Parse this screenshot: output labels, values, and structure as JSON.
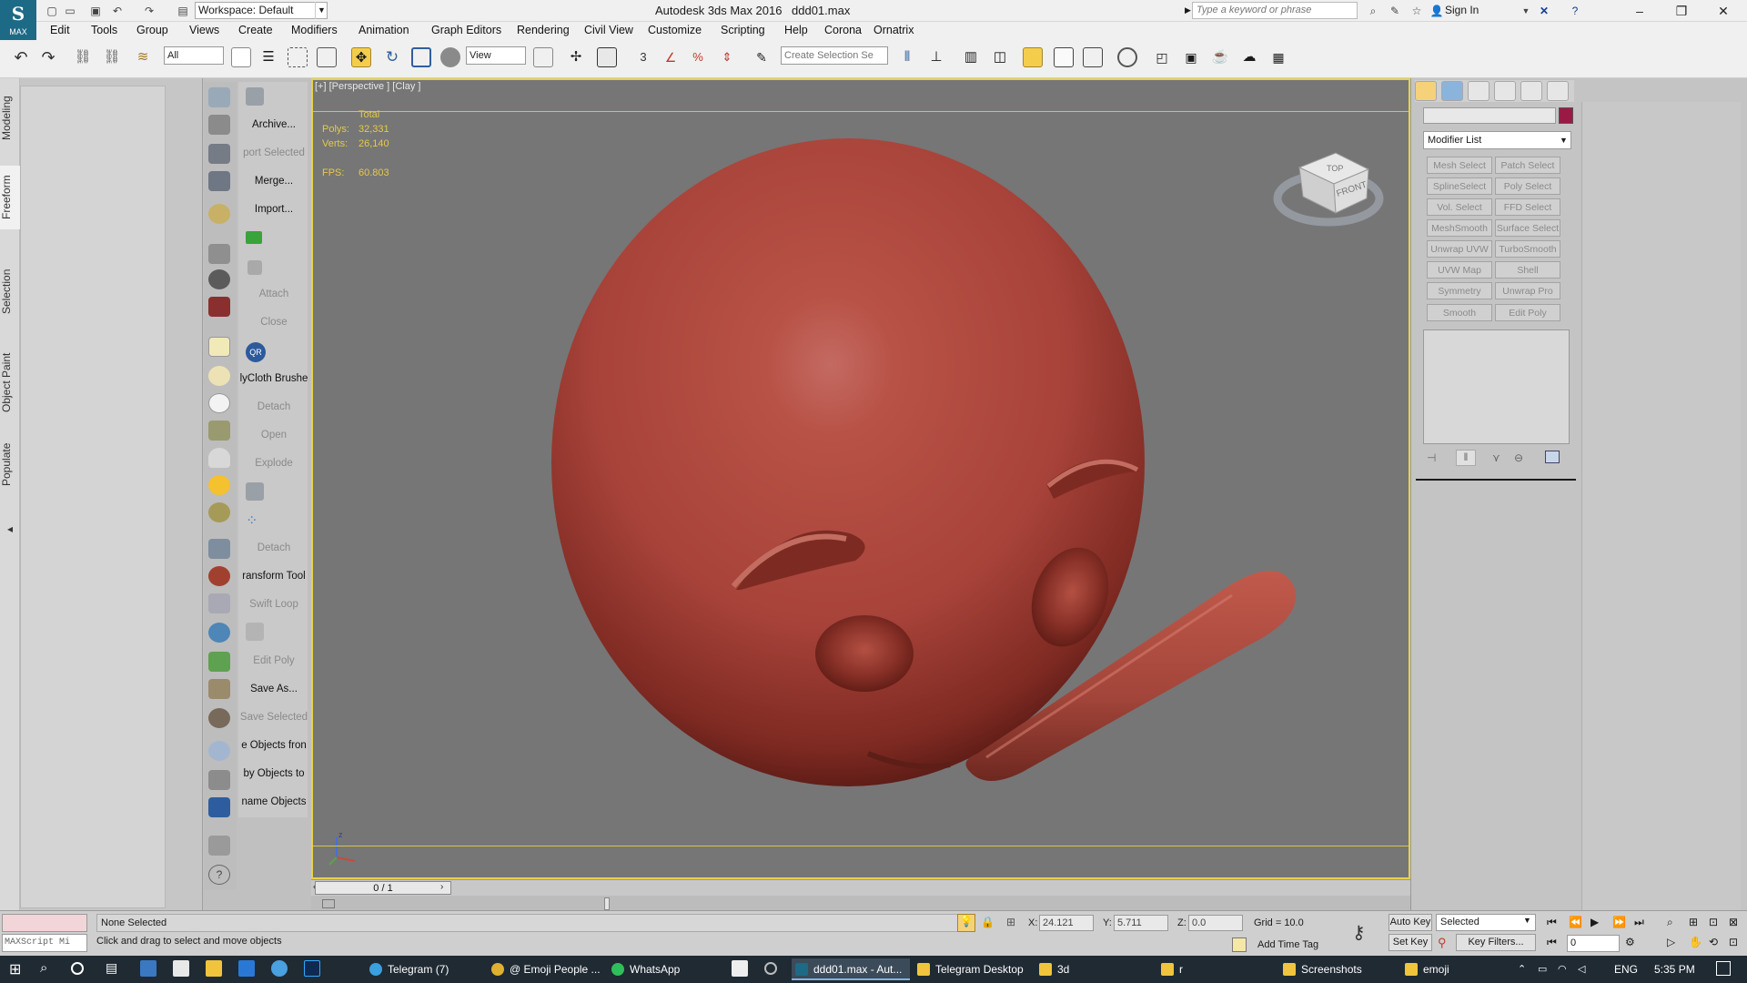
{
  "titlebar": {
    "app_logo_text": "MAX",
    "workspace": "Workspace: Default",
    "app_title": "Autodesk 3ds Max 2016",
    "file_title": "ddd01.max",
    "search_placeholder": "Type a keyword or phrase",
    "sign_in": "Sign In"
  },
  "menu": [
    "Edit",
    "Tools",
    "Group",
    "Views",
    "Create",
    "Modifiers",
    "Animation",
    "Graph Editors",
    "Rendering",
    "Civil View",
    "Customize",
    "Scripting",
    "Help",
    "Corona",
    "Ornatrix"
  ],
  "toolbar": {
    "selection_filter": "All",
    "reference_coord": "View",
    "selection_set_placeholder": "Create Selection Se",
    "snap_label": "3"
  },
  "ribbon_tabs": [
    "Modeling",
    "Freeform",
    "Selection",
    "Object Paint",
    "Populate"
  ],
  "tool_labels": [
    {
      "text": "Archive...",
      "dim": false
    },
    {
      "text": "port Selected",
      "dim": true
    },
    {
      "text": "Merge...",
      "dim": false
    },
    {
      "text": "Import...",
      "dim": false
    },
    {
      "text": "Attach",
      "dim": true
    },
    {
      "text": "Close",
      "dim": true
    },
    {
      "text": "lyCloth Brushe",
      "dim": false
    },
    {
      "text": "Detach",
      "dim": true
    },
    {
      "text": "Open",
      "dim": true
    },
    {
      "text": "Explode",
      "dim": true
    },
    {
      "text": "Detach",
      "dim": true
    },
    {
      "text": "ransform Tool",
      "dim": false
    },
    {
      "text": "Swift Loop",
      "dim": true
    },
    {
      "text": "Edit Poly",
      "dim": true
    },
    {
      "text": "Save As...",
      "dim": false
    },
    {
      "text": "Save Selected",
      "dim": true
    },
    {
      "text": "e Objects fron",
      "dim": false
    },
    {
      "text": "by Objects to",
      "dim": false
    },
    {
      "text": "name Objects",
      "dim": false
    }
  ],
  "viewport": {
    "label": "[+] [Perspective ] [Clay ]",
    "stats_header": "Total",
    "polys_label": "Polys:",
    "polys_value": "32,331",
    "verts_label": "Verts:",
    "verts_value": "26,140",
    "fps_label": "FPS:",
    "fps_value": "60.803",
    "viewcube_top": "TOP",
    "viewcube_front": "FRONT",
    "axis_z": "z"
  },
  "timeline": {
    "slider": "0 / 1"
  },
  "command_panel": {
    "modifier_list": "Modifier List",
    "modifier_buttons": [
      [
        "Mesh Select",
        "Patch Select"
      ],
      [
        "SplineSelect",
        "Poly Select"
      ],
      [
        "Vol. Select",
        "FFD Select"
      ],
      [
        "MeshSmooth",
        "Surface Select"
      ],
      [
        "Unwrap UVW",
        "TurboSmooth"
      ],
      [
        "UVW Map",
        "Shell"
      ],
      [
        "Symmetry",
        "Unwrap Pro"
      ],
      [
        "Smooth",
        "Edit Poly"
      ]
    ],
    "swatch_color": "#9b1a45"
  },
  "status": {
    "maxscript": "MAXScript Mi",
    "selection": "None Selected",
    "prompt": "Click and drag to select and move objects",
    "x_label": "X:",
    "x_value": "24.121",
    "y_label": "Y:",
    "y_value": "5.711",
    "z_label": "Z:",
    "z_value": "0.0",
    "grid": "Grid = 10.0",
    "add_time_tag": "Add Time Tag",
    "auto_key": "Auto Key",
    "set_key": "Set Key",
    "key_mode": "Selected",
    "key_filters": "Key Filters...",
    "frame": "0"
  },
  "taskbar": {
    "items": [
      "Telegram (7)",
      "@ Emoji People ...",
      "WhatsApp",
      "ddd01.max - Aut...",
      "Telegram Desktop",
      "3d",
      "r",
      "Screenshots",
      "emoji"
    ],
    "language": "ENG",
    "time": "5:35 PM"
  }
}
